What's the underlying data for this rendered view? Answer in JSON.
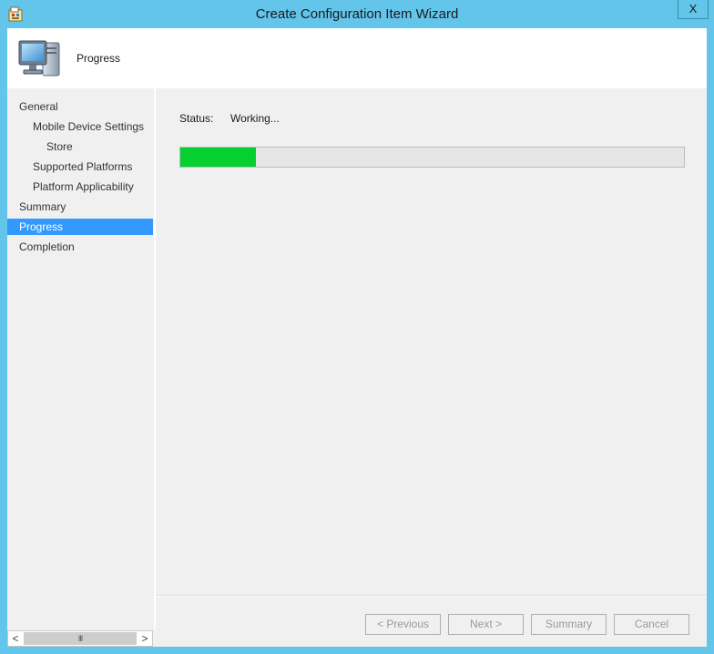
{
  "window": {
    "title": "Create Configuration Item Wizard",
    "close_glyph": "X"
  },
  "header": {
    "title": "Progress",
    "icon": "computer-monitor-icon"
  },
  "nav": {
    "items": [
      {
        "label": "General"
      },
      {
        "label": "Mobile Device Settings"
      },
      {
        "label": "Store"
      },
      {
        "label": "Supported Platforms"
      },
      {
        "label": "Platform Applicability"
      },
      {
        "label": "Summary"
      },
      {
        "label": "Progress",
        "selected": true
      },
      {
        "label": "Completion"
      }
    ]
  },
  "main": {
    "status_label": "Status:",
    "status_value": "Working...",
    "progress_fraction": 0.15,
    "progress_color": "#06d02f"
  },
  "scrollbar": {
    "left_arrow": "<",
    "right_arrow": ">",
    "thumb_grip": "III"
  },
  "buttons": {
    "previous": "< Previous",
    "next": "Next >",
    "summary": "Summary",
    "cancel": "Cancel"
  },
  "colors": {
    "titlebar": "#63c5ea",
    "selection": "#3399ff"
  }
}
